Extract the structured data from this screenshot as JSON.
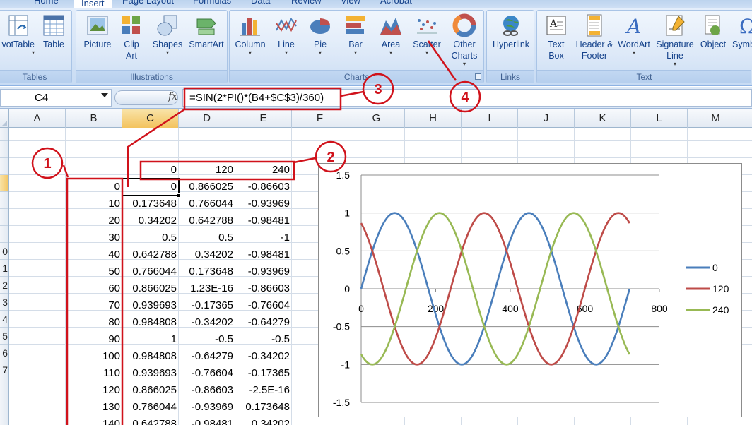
{
  "ribbon": {
    "tabs": [
      {
        "label": "Home"
      },
      {
        "label": "Insert",
        "active": true
      },
      {
        "label": "Page Layout"
      },
      {
        "label": "Formulas"
      },
      {
        "label": "Data"
      },
      {
        "label": "Review"
      },
      {
        "label": "View"
      },
      {
        "label": "Acrobat"
      }
    ],
    "groups": {
      "tables": {
        "label": "Tables",
        "buttons": [
          {
            "label": "votTable",
            "icon": "pivottable-icon"
          },
          {
            "label": "Table",
            "icon": "table-icon"
          }
        ]
      },
      "illustrations": {
        "label": "Illustrations",
        "buttons": [
          {
            "label": "Picture",
            "icon": "picture-icon"
          },
          {
            "label": "Clip Art",
            "icon": "clip-art-icon"
          },
          {
            "label": "Shapes",
            "icon": "shapes-icon"
          },
          {
            "label": "SmartArt",
            "icon": "smartart-icon"
          }
        ]
      },
      "charts": {
        "label": "Charts",
        "buttons": [
          {
            "label": "Column",
            "icon": "column-chart-icon"
          },
          {
            "label": "Line",
            "icon": "line-chart-icon"
          },
          {
            "label": "Pie",
            "icon": "pie-chart-icon"
          },
          {
            "label": "Bar",
            "icon": "bar-chart-icon"
          },
          {
            "label": "Area",
            "icon": "area-chart-icon"
          },
          {
            "label": "Scatter",
            "icon": "scatter-chart-icon"
          },
          {
            "label": "Other Charts",
            "icon": "other-charts-icon"
          }
        ]
      },
      "links": {
        "label": "Links",
        "buttons": [
          {
            "label": "Hyperlink",
            "icon": "hyperlink-icon"
          }
        ]
      },
      "text": {
        "label": "Text",
        "buttons": [
          {
            "label": "Text Box",
            "icon": "text-box-icon"
          },
          {
            "label": "Header & Footer",
            "icon": "header-footer-icon"
          },
          {
            "label": "WordArt",
            "icon": "wordart-icon"
          },
          {
            "label": "Signature Line",
            "icon": "signature-line-icon"
          },
          {
            "label": "Object",
            "icon": "object-icon"
          },
          {
            "label": "Symb",
            "icon": "symbol-icon"
          }
        ]
      }
    }
  },
  "formula_bar": {
    "name_box": "C4",
    "fx_label": "fx",
    "formula": "=SIN(2*PI()*(B4+$C$3)/360)"
  },
  "grid": {
    "columns": [
      "A",
      "B",
      "C",
      "D",
      "E",
      "F",
      "G",
      "H",
      "I",
      "J",
      "K",
      "L",
      "M"
    ],
    "selected_column": "C",
    "row_numbers": [
      "",
      "",
      "",
      "",
      "",
      "",
      "",
      "0",
      "1",
      "2",
      "3",
      "4",
      "5",
      "6",
      "7",
      ""
    ],
    "selected_row_index": 3,
    "header_row": {
      "c": "0",
      "d": "120",
      "e": "240"
    },
    "rows": [
      {
        "b": "0",
        "c": "0",
        "d": "0.866025",
        "e": "-0.86603"
      },
      {
        "b": "10",
        "c": "0.173648",
        "d": "0.766044",
        "e": "-0.93969"
      },
      {
        "b": "20",
        "c": "0.34202",
        "d": "0.642788",
        "e": "-0.98481"
      },
      {
        "b": "30",
        "c": "0.5",
        "d": "0.5",
        "e": "-1"
      },
      {
        "b": "40",
        "c": "0.642788",
        "d": "0.34202",
        "e": "-0.98481"
      },
      {
        "b": "50",
        "c": "0.766044",
        "d": "0.173648",
        "e": "-0.93969"
      },
      {
        "b": "60",
        "c": "0.866025",
        "d": "1.23E-16",
        "e": "-0.86603"
      },
      {
        "b": "70",
        "c": "0.939693",
        "d": "-0.17365",
        "e": "-0.76604"
      },
      {
        "b": "80",
        "c": "0.984808",
        "d": "-0.34202",
        "e": "-0.64279"
      },
      {
        "b": "90",
        "c": "1",
        "d": "-0.5",
        "e": "-0.5"
      },
      {
        "b": "100",
        "c": "0.984808",
        "d": "-0.64279",
        "e": "-0.34202"
      },
      {
        "b": "110",
        "c": "0.939693",
        "d": "-0.76604",
        "e": "-0.17365"
      },
      {
        "b": "120",
        "c": "0.866025",
        "d": "-0.86603",
        "e": "-2.5E-16"
      },
      {
        "b": "130",
        "c": "0.766044",
        "d": "-0.93969",
        "e": "0.173648"
      },
      {
        "b": "140",
        "c": "0.642788",
        "d": "-0.98481",
        "e": "0.34202"
      }
    ]
  },
  "chart_data": {
    "type": "scatter",
    "title": "",
    "xlabel": "",
    "ylabel": "",
    "xlim": [
      0,
      800
    ],
    "ylim": [
      -1.5,
      1.5
    ],
    "x_ticks": [
      "0",
      "200",
      "400",
      "600",
      "800"
    ],
    "y_ticks": [
      "1.5",
      "1",
      "0.5",
      "0",
      "-0.5",
      "-1",
      "-1.5"
    ],
    "grid": true,
    "legend_position": "right",
    "x": [
      0,
      10,
      20,
      30,
      40,
      50,
      60,
      70,
      80,
      90,
      100,
      110,
      120,
      130,
      140,
      150,
      160,
      170,
      180,
      190,
      200,
      210,
      220,
      230,
      240,
      250,
      260,
      270,
      280,
      290,
      300,
      310,
      320,
      330,
      340,
      350,
      360,
      370,
      380,
      390,
      400,
      410,
      420,
      430,
      440,
      450,
      460,
      470,
      480,
      490,
      500,
      510,
      520,
      530,
      540,
      550,
      560,
      570,
      580,
      590,
      600,
      610,
      620,
      630,
      640,
      650,
      660,
      670,
      680,
      690,
      700,
      710,
      720
    ],
    "series": [
      {
        "name": "0",
        "color": "#4a7ebb",
        "phase": 0,
        "formula": "sin(2*pi*(x+phase)/360)"
      },
      {
        "name": "120",
        "color": "#be4b48",
        "phase": 120,
        "formula": "sin(2*pi*(x+phase)/360)"
      },
      {
        "name": "240",
        "color": "#98b954",
        "phase": 240,
        "formula": "sin(2*pi*(x+phase)/360)"
      }
    ]
  },
  "annotations": [
    {
      "number": "1",
      "color": "#d0121b"
    },
    {
      "number": "2",
      "color": "#d0121b"
    },
    {
      "number": "3",
      "color": "#d0121b"
    },
    {
      "number": "4",
      "color": "#d0121b"
    }
  ]
}
